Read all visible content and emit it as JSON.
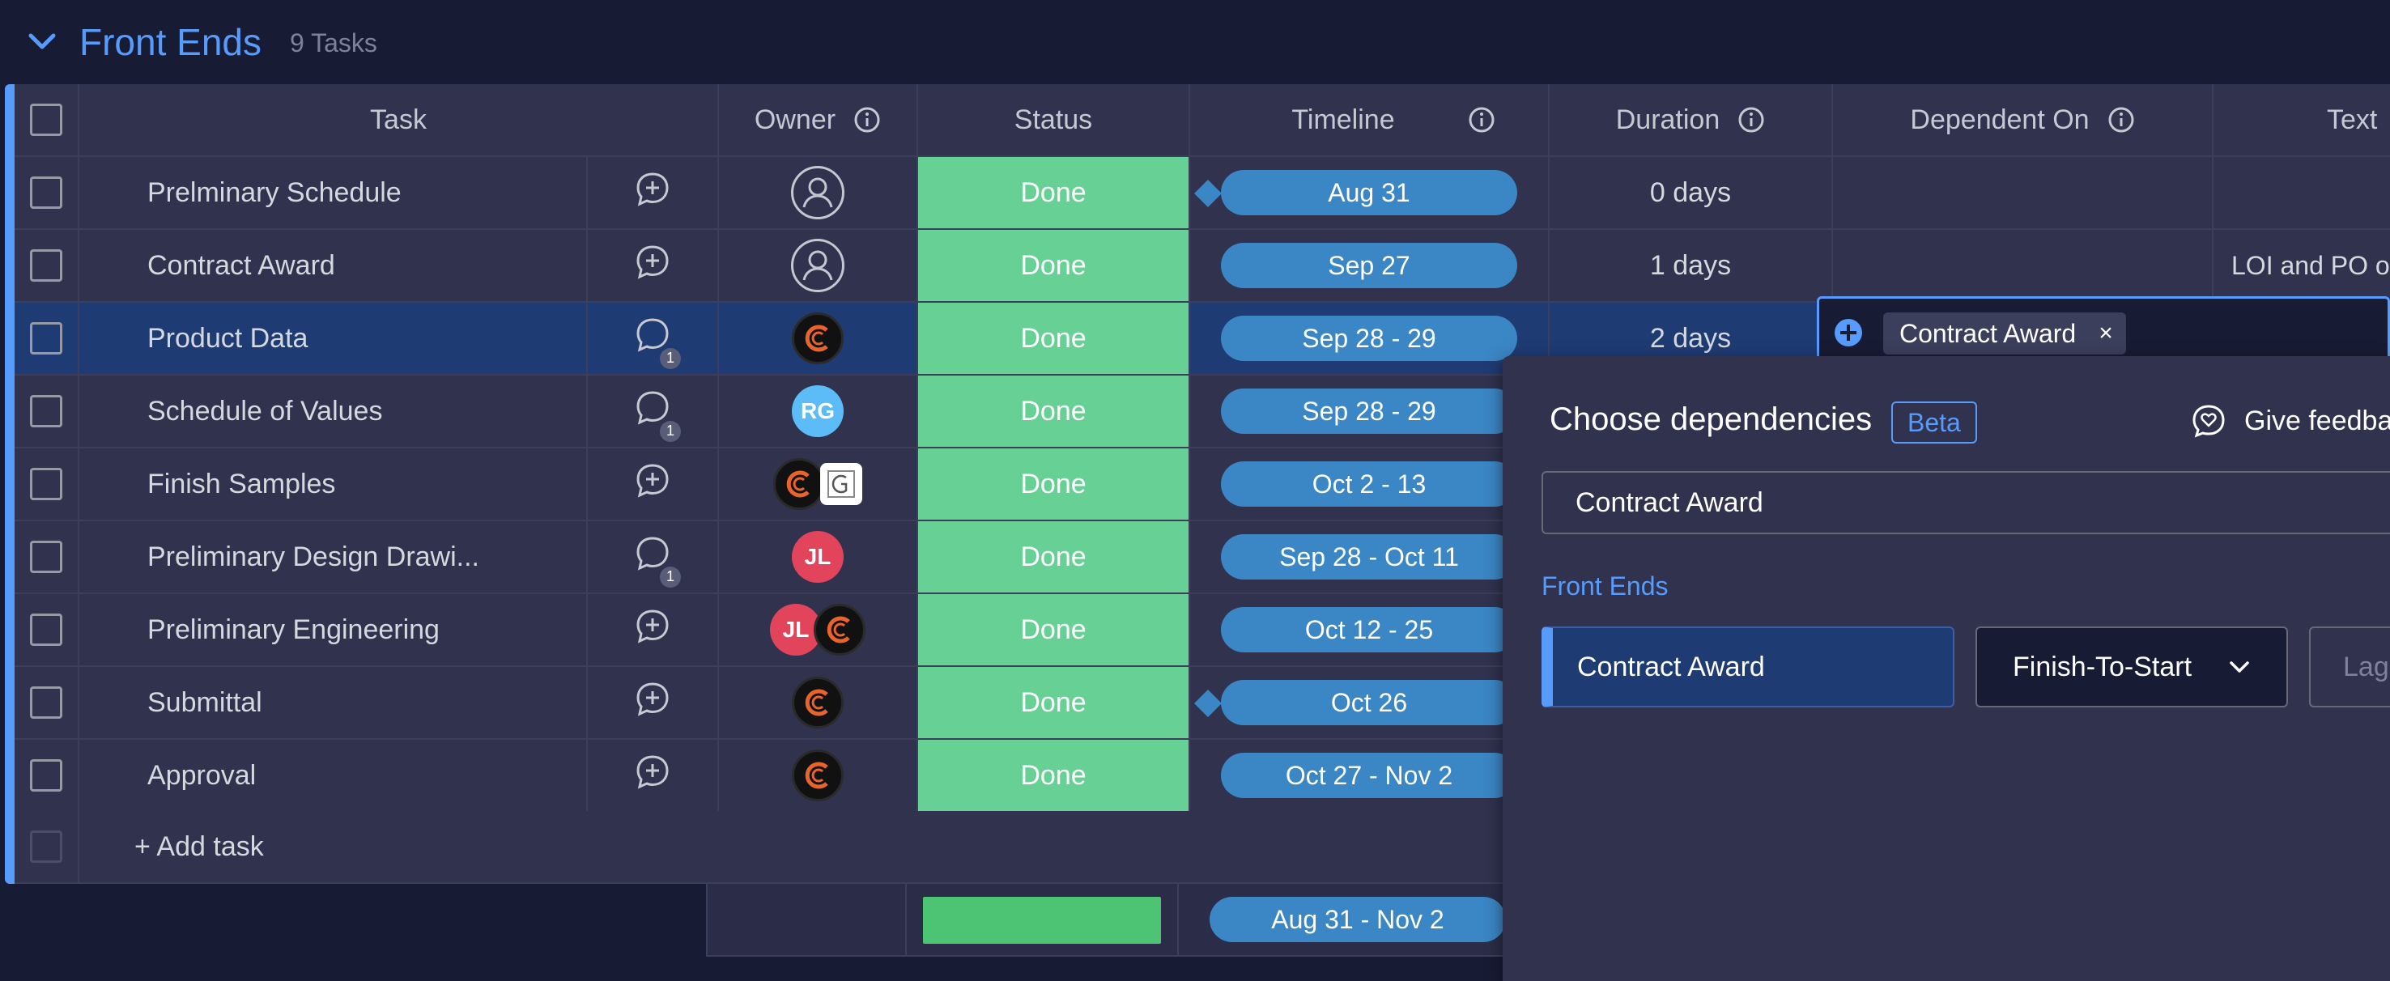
{
  "group": {
    "title": "Front Ends",
    "count": "9 Tasks"
  },
  "columns": {
    "task": "Task",
    "owner": "Owner",
    "status": "Status",
    "timeline": "Timeline",
    "duration": "Duration",
    "dependent_on": "Dependent On",
    "text": "Text"
  },
  "rows": [
    {
      "name": "Prelminary Schedule",
      "status": "Done",
      "timeline": "Aug 31",
      "duration": "0 days",
      "text": ""
    },
    {
      "name": "Contract Award",
      "status": "Done",
      "timeline": "Sep 27",
      "duration": "1 days",
      "text": "LOI and PO on"
    },
    {
      "name": "Product Data",
      "status": "Done",
      "timeline": "Sep 28 - 29",
      "duration": "2 days",
      "text": "",
      "updates": "1"
    },
    {
      "name": "Schedule of Values",
      "status": "Done",
      "timeline": "Sep 28 - 29",
      "duration": "",
      "text": "",
      "updates": "1",
      "owner": "RG"
    },
    {
      "name": "Finish Samples",
      "status": "Done",
      "timeline": "Oct 2 - 13",
      "duration": "",
      "text": ""
    },
    {
      "name": "Preliminary Design Drawi...",
      "status": "Done",
      "timeline": "Sep 28 - Oct 11",
      "duration": "",
      "text": "",
      "updates": "1",
      "owner": "JL"
    },
    {
      "name": "Preliminary Engineering",
      "status": "Done",
      "timeline": "Oct 12 - 25",
      "duration": "",
      "text": "",
      "owner": "JL"
    },
    {
      "name": "Submittal",
      "status": "Done",
      "timeline": "Oct 26",
      "duration": "",
      "text": ""
    },
    {
      "name": "Approval",
      "status": "Done",
      "timeline": "Oct 27 - Nov 2",
      "duration": "",
      "text": ""
    }
  ],
  "add_task": "+ Add task",
  "footer": {
    "timeline": "Aug 31 - Nov 2"
  },
  "dependency_picker": {
    "selected_tag": "Contract Award",
    "tag_close": "×",
    "title": "Choose dependencies",
    "beta": "Beta",
    "feedback": "Give feedba",
    "search_value": "Contract Award",
    "section": "Front Ends",
    "item": "Contract Award",
    "type": "Finish-To-Start",
    "lag_placeholder": "Lag"
  },
  "colors": {
    "accent": "#579bfc",
    "done": "#67d094",
    "timeline": "#3b86c4",
    "selected_row": "#1f3b73"
  }
}
